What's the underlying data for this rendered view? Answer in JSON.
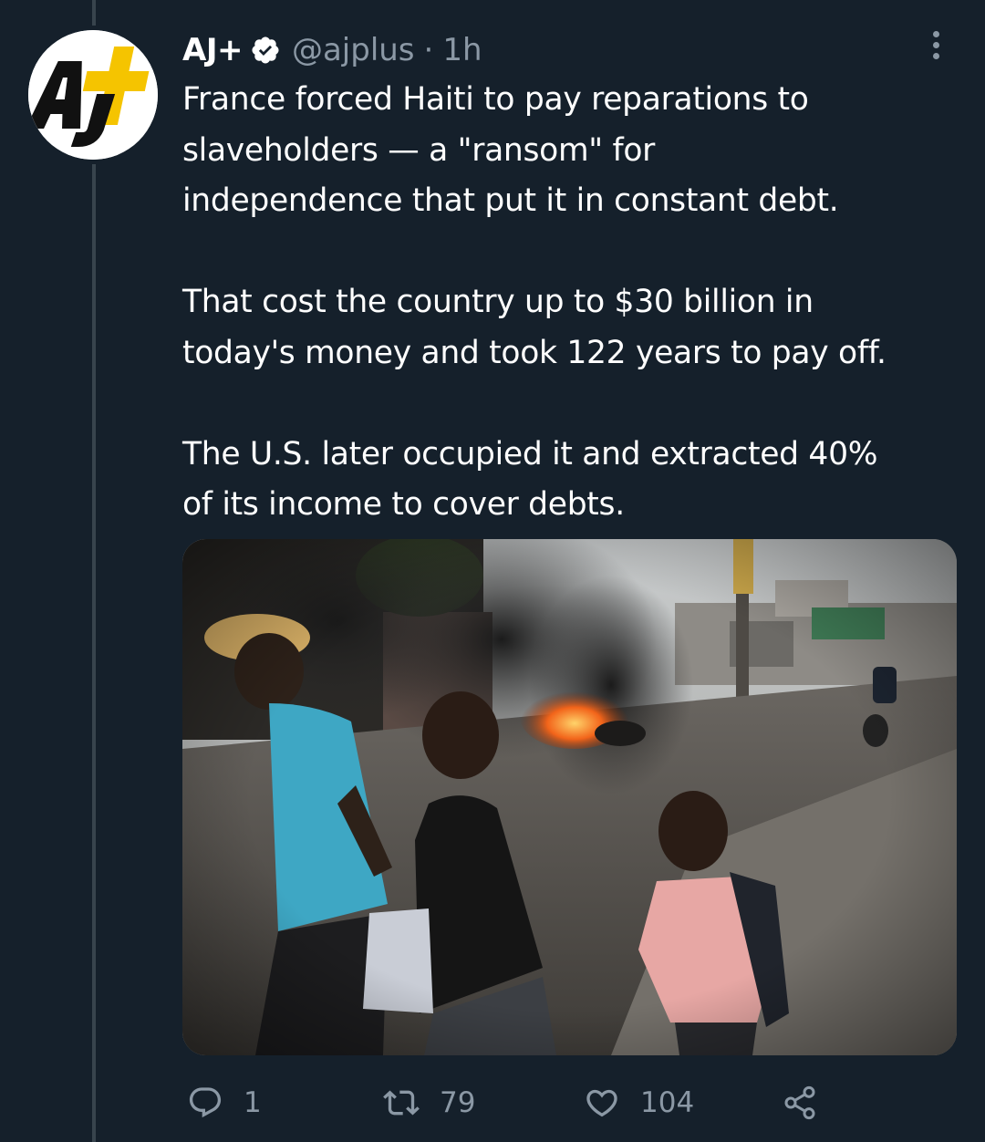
{
  "tweet": {
    "display_name": "AJ+",
    "verified": true,
    "handle": "@ajplus",
    "separator": "·",
    "time": "1h",
    "avatar_logo": "AJ+",
    "paragraphs": [
      [
        "France forced Haiti to pay reparations to",
        "slaveholders — a \"ransom\" for",
        "independence that put it in constant debt."
      ],
      [
        "That cost the country up to $30 billion in",
        "today's money and took 122 years to pay off."
      ],
      [
        "The U.S. later occupied it and extracted 40%",
        "of its income to cover debts."
      ]
    ],
    "media": {
      "kind": "photo",
      "depicts": "burning-tires-street-people-walking"
    }
  },
  "actions": {
    "reply_count": "1",
    "retweet_count": "79",
    "like_count": "104"
  },
  "icons": {
    "more": "more-options-icon",
    "verified": "verified-badge-icon",
    "reply": "reply-icon",
    "retweet": "retweet-icon",
    "like": "heart-icon",
    "share": "share-icon"
  },
  "colors": {
    "background": "#15202b",
    "text": "#ffffff",
    "muted": "#8b98a5",
    "thread_line": "#38444d",
    "logo_yellow": "#f5c400"
  }
}
